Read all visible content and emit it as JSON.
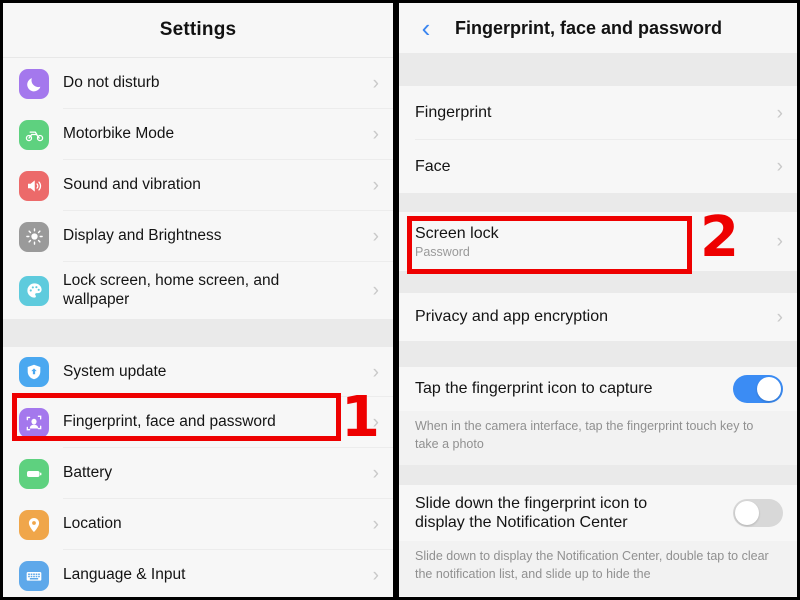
{
  "left_panel": {
    "header_title": "Settings",
    "items": [
      {
        "label": "Do not disturb",
        "icon": "moon-icon",
        "color": "#a478ed"
      },
      {
        "label": "Motorbike Mode",
        "icon": "motorbike-icon",
        "color": "#5ed17f"
      },
      {
        "label": "Sound and vibration",
        "icon": "speaker-icon",
        "color": "#ec6a6a"
      },
      {
        "label": "Display and Brightness",
        "icon": "brightness-icon",
        "color": "#9a9a9a"
      },
      {
        "label": "Lock screen, home screen, and wallpaper",
        "icon": "palette-icon",
        "color": "#5ecbdd"
      }
    ],
    "items_group2": [
      {
        "label": "System update",
        "icon": "system-update-icon",
        "color": "#4aa8f0"
      },
      {
        "label": "Fingerprint, face and password",
        "icon": "fingerprint-face-icon",
        "color": "#a478ed"
      },
      {
        "label": "Battery",
        "icon": "battery-icon",
        "color": "#5ed17f"
      },
      {
        "label": "Location",
        "icon": "location-pin-icon",
        "color": "#f0a64a"
      },
      {
        "label": "Language & Input",
        "icon": "keyboard-icon",
        "color": "#5ea8ea"
      }
    ]
  },
  "right_panel": {
    "header_title": "Fingerprint, face and password",
    "back_icon": "back-chevron-icon",
    "group1": [
      {
        "label": "Fingerprint"
      },
      {
        "label": "Face"
      }
    ],
    "group2": [
      {
        "label": "Screen lock",
        "sublabel": "Password"
      }
    ],
    "group3": [
      {
        "label": "Privacy and app encryption"
      }
    ],
    "toggle_rows": [
      {
        "label": "Tap the fingerprint icon to capture",
        "state": "on",
        "description": "When in the camera interface, tap the fingerprint touch key to take a photo"
      },
      {
        "label": "Slide down the fingerprint icon to display the Notification Center",
        "state": "off",
        "description": "Slide down to display the Notification Center, double tap to clear the notification list, and slide up to hide the"
      }
    ]
  },
  "annotations": {
    "step1_number": "1",
    "step2_number": "2",
    "highlight_color": "#ee0000"
  }
}
